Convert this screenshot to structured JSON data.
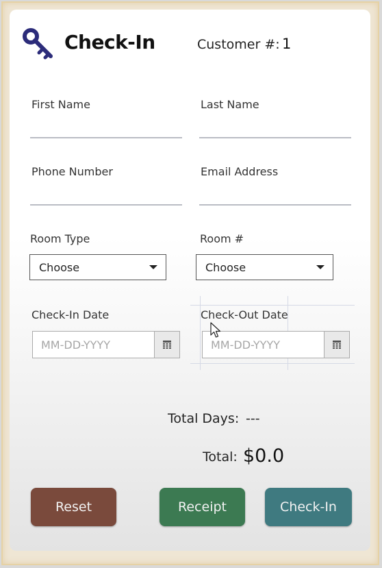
{
  "header": {
    "title": "Check-In",
    "customer_label": "Customer #:",
    "customer_number": "1"
  },
  "fields": {
    "first_name": {
      "label": "First Name",
      "value": ""
    },
    "last_name": {
      "label": "Last Name",
      "value": ""
    },
    "phone": {
      "label": "Phone Number",
      "value": ""
    },
    "email": {
      "label": "Email Address",
      "value": ""
    }
  },
  "room_type": {
    "label": "Room Type",
    "selected": "Choose"
  },
  "room_number": {
    "label": "Room #",
    "selected": "Choose"
  },
  "check_in_date": {
    "label": "Check-In Date",
    "placeholder": "MM-DD-YYYY"
  },
  "check_out_date": {
    "label": "Check-Out Date",
    "placeholder": "MM-DD-YYYY"
  },
  "summary": {
    "days_label": "Total Days:",
    "days_value": "---",
    "total_label": "Total:",
    "total_value": "$0.0"
  },
  "buttons": {
    "reset": "Reset",
    "receipt": "Receipt",
    "checkin": "Check-In"
  },
  "colors": {
    "reset": "#7a4a3c",
    "receipt": "#3c7a52",
    "checkin": "#3f7a80",
    "icon": "#2c2c7a"
  },
  "icons": {
    "logo": "key-icon",
    "calendar": "calendar-icon",
    "cursor": "mouse-cursor-icon"
  }
}
